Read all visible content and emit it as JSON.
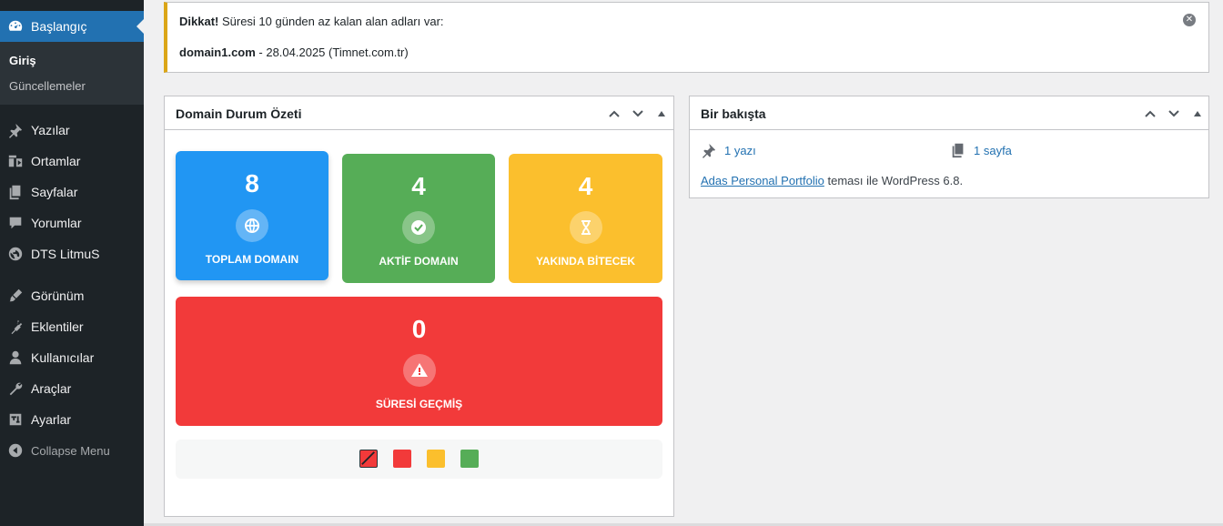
{
  "sidebar": {
    "dashboard_label": "Başlangıç",
    "submenu": [
      {
        "label": "Giriş"
      },
      {
        "label": "Güncellemeler"
      }
    ],
    "items": [
      {
        "label": "Yazılar",
        "icon": "pin-icon"
      },
      {
        "label": "Ortamlar",
        "icon": "media-icon"
      },
      {
        "label": "Sayfalar",
        "icon": "pages-icon"
      },
      {
        "label": "Yorumlar",
        "icon": "comments-icon"
      },
      {
        "label": "DTS LitmuS",
        "icon": "globe-icon"
      },
      {
        "label": "Görünüm",
        "icon": "appearance-icon"
      },
      {
        "label": "Eklentiler",
        "icon": "plugins-icon"
      },
      {
        "label": "Kullanıcılar",
        "icon": "users-icon"
      },
      {
        "label": "Araçlar",
        "icon": "tools-icon"
      },
      {
        "label": "Ayarlar",
        "icon": "settings-icon"
      }
    ],
    "collapse_label": "Collapse Menu",
    "active_color": "#2271b1"
  },
  "notice": {
    "bold": "Dikkat!",
    "message": " Süresi 10 günden az kalan alan adları var:",
    "domain": "domain1.com",
    "detail": " - 28.04.2025 (Timnet.com.tr)",
    "border_color": "#dba617"
  },
  "domain_box": {
    "title": "Domain Durum Özeti",
    "cards": {
      "total": {
        "value": "8",
        "label": "TOPLAM DOMAIN",
        "color": "#2196f3",
        "icon": "globe-icon"
      },
      "active": {
        "value": "4",
        "label": "AKTİF DOMAIN",
        "color": "#56ad57",
        "icon": "check-circle-icon"
      },
      "soon": {
        "value": "4",
        "label": "YAKINDA BİTECEK",
        "color": "#fbbf2d",
        "icon": "hourglass-icon"
      },
      "expired": {
        "value": "0",
        "label": "SÜRESİ GEÇMİŞ",
        "color": "#f23a3a",
        "icon": "warning-icon"
      }
    },
    "legend_colors": [
      "#f23a3a",
      "#f23a3a",
      "#fbbf2d",
      "#56ad57"
    ]
  },
  "glance_box": {
    "title": "Bir bakışta",
    "posts": "1 yazı",
    "pages": "1 sayfa",
    "theme_link": "Adas Personal Portfolio",
    "theme_suffix": " teması ile WordPress 6.8."
  }
}
